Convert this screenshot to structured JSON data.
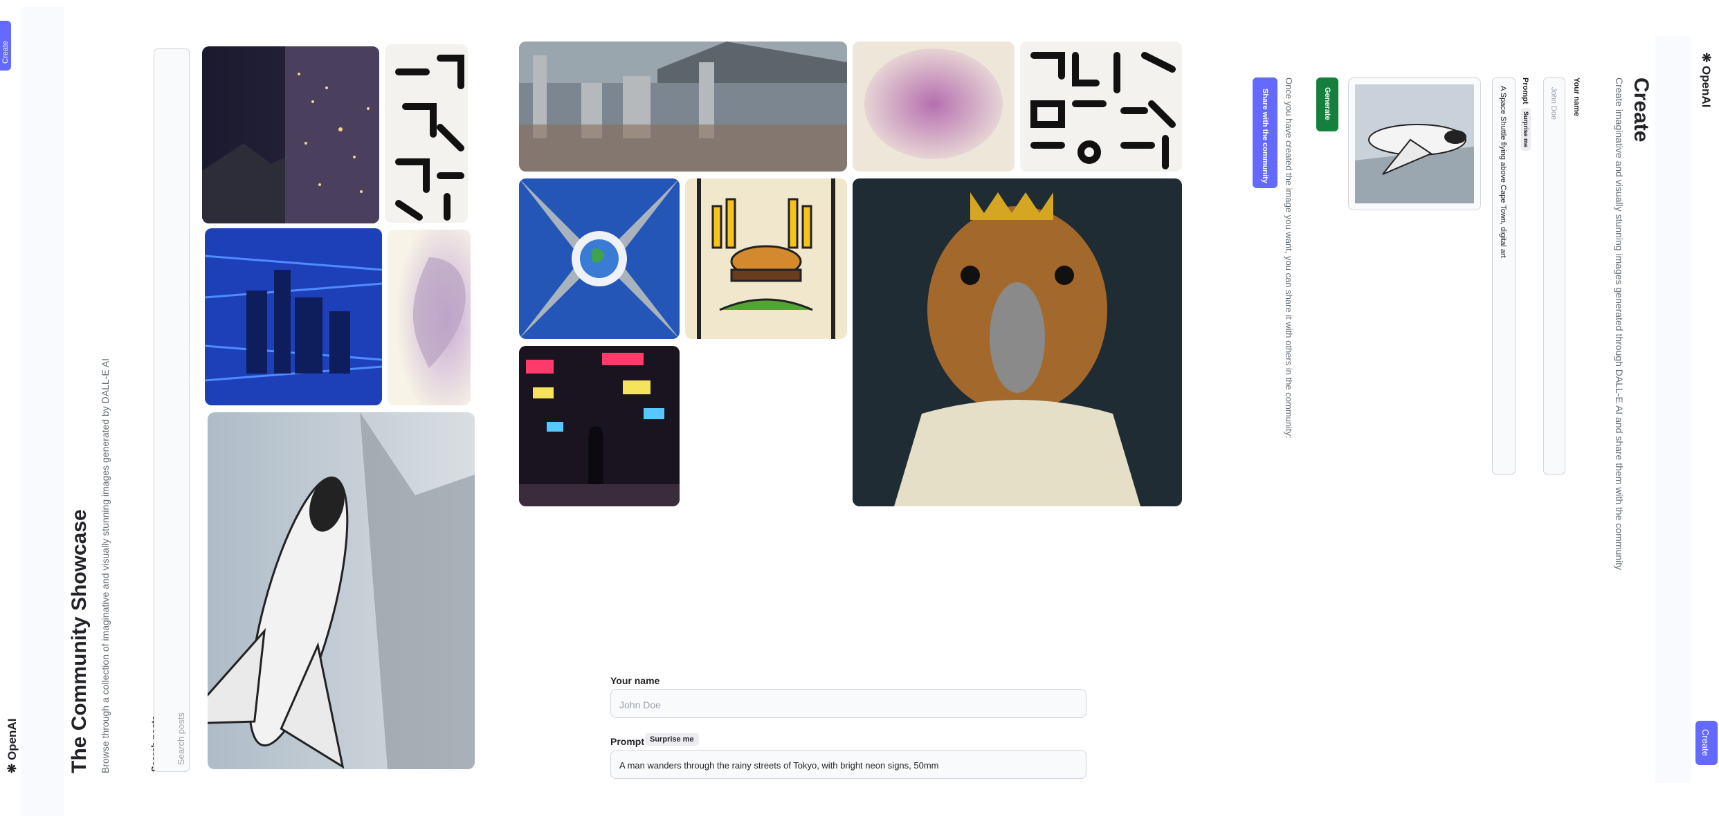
{
  "home": {
    "brand": "OpenAI",
    "create_button": "Create",
    "title": "The Community Showcase",
    "subtitle": "Browse through a collection of imaginative and visually stunning images generated by DALL-E AI",
    "search_label": "Search posts",
    "search_placeholder": "Search posts"
  },
  "gallery": {
    "images": [
      "city-night",
      "korean-letters",
      "blue-skyline",
      "purple-heart",
      "space-shuttle"
    ]
  },
  "mid_gallery": {
    "images": [
      "city-aerial",
      "heart-stone",
      "hangul-letters",
      "earth-between-buildings",
      "burger-stained-glass",
      "capybara-king",
      "tokyo-neon-street"
    ]
  },
  "form": {
    "name_label": "Your name",
    "name_placeholder": "John Doe",
    "prompt_label": "Prompt",
    "surprise_label": "Surprise me",
    "prompt_value": "A man wanders through the rainy streets of Tokyo, with bright neon signs, 50mm"
  },
  "create": {
    "brand": "OpenAI",
    "create_button": "Create",
    "title": "Create",
    "subtitle": "Create imaginative and visually stunning images generated through DALL-E AI and share them with the community",
    "name_label": "Your name",
    "name_placeholder": "John Doe",
    "prompt_label": "Prompt",
    "surprise_label": "Surprise me",
    "prompt_value": "A Space Shuttle flying above Cape Town, digital art",
    "generate_label": "Generate",
    "share_text": "Once you have created the image you want, you can share it with others in the community:",
    "share_button": "Share with the community"
  },
  "colors": {
    "primary": "#6469ff",
    "generate": "#15803d",
    "text": "#222328",
    "muted": "#666e75",
    "input_bg": "#f9fafb",
    "border": "#d1d5db"
  }
}
